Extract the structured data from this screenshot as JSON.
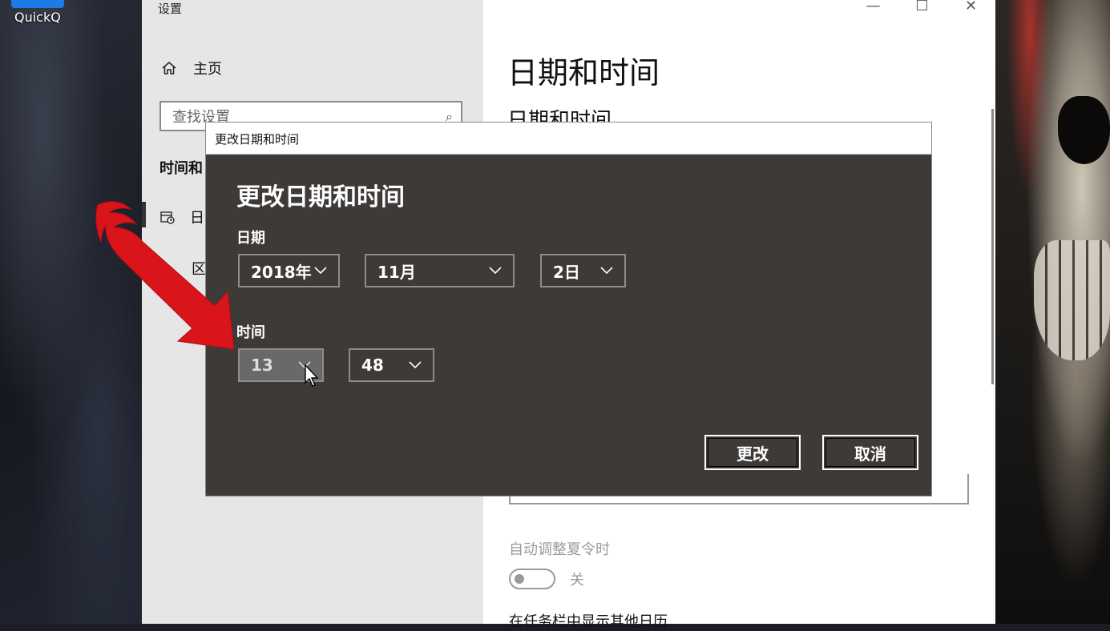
{
  "desktop": {
    "icon_label": "QuickQ"
  },
  "settings_window": {
    "title": "设置",
    "controls": {
      "minimize": "—",
      "maximize": "☐",
      "close": "✕"
    },
    "nav": {
      "home_label": "主页",
      "search_placeholder": "查找设置",
      "section_title": "时间和",
      "item_date_label": "日",
      "item_region_label": "区"
    },
    "content": {
      "page_title": "日期和时间",
      "section_title": "日期和时间",
      "dst_label": "自动调整夏令时",
      "dst_state": "关",
      "extra_calendars_label": "在任务栏中显示其他日历"
    }
  },
  "dialog": {
    "titlebar": "更改日期和时间",
    "heading": "更改日期和时间",
    "date_label": "日期",
    "year_value": "2018年",
    "month_value": "11月",
    "day_value": "2日",
    "time_label": "时间",
    "hour_value": "13",
    "minute_value": "48",
    "change_button": "更改",
    "cancel_button": "取消"
  },
  "colors": {
    "dialog_bg": "#3d3a38",
    "nav_bg": "#e6e6e6",
    "annotation_arrow": "#d9141b"
  },
  "icons": [
    "home-icon",
    "search-icon",
    "calendar-clock-icon",
    "chevron-down-icon",
    "mouse-pointer-icon",
    "red-arrow-annotation"
  ]
}
